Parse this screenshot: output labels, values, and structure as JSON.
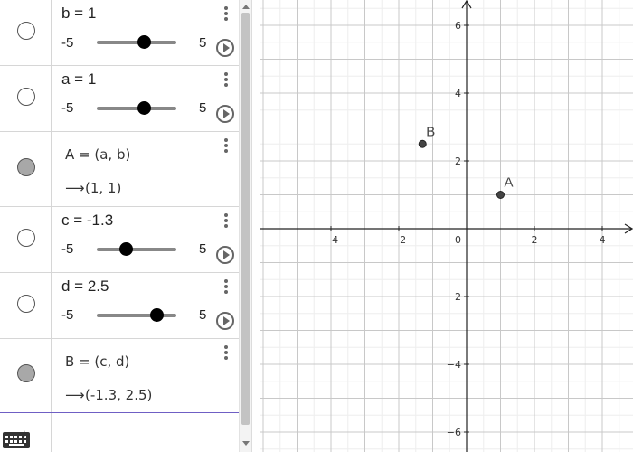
{
  "algebra": {
    "rows": [
      {
        "type": "slider",
        "label": "b = 1",
        "value": 1,
        "min_label": "-5",
        "max_label": "5",
        "min": -5,
        "max": 5
      },
      {
        "type": "slider",
        "label": "a = 1",
        "value": 1,
        "min_label": "-5",
        "max_label": "5",
        "min": -5,
        "max": 5
      },
      {
        "type": "point",
        "definition": "A = (a, b)",
        "result": "(1, 1)"
      },
      {
        "type": "slider",
        "label": "c = -1.3",
        "value": -1.3,
        "min_label": "-5",
        "max_label": "5",
        "min": -5,
        "max": 5
      },
      {
        "type": "slider",
        "label": "d = 2.5",
        "value": 2.5,
        "min_label": "-5",
        "max_label": "5",
        "min": -5,
        "max": 5
      },
      {
        "type": "point",
        "definition": "B = (c, d)",
        "result": "(-1.3, 2.5)"
      }
    ],
    "arrow_glyph": "⟶",
    "input_plus": "+"
  },
  "graphics": {
    "x_ticks": [
      {
        "value": -4,
        "label": "−4"
      },
      {
        "value": -2,
        "label": "−2"
      },
      {
        "value": 2,
        "label": "2"
      },
      {
        "value": 4,
        "label": "4"
      }
    ],
    "y_ticks": [
      {
        "value": 6,
        "label": "6"
      },
      {
        "value": 4,
        "label": "4"
      },
      {
        "value": 2,
        "label": "2"
      },
      {
        "value": -2,
        "label": "−2"
      },
      {
        "value": -4,
        "label": "−4"
      },
      {
        "value": -6,
        "label": "−6"
      }
    ],
    "origin_label": "0",
    "points": [
      {
        "name": "A",
        "x": 1,
        "y": 1
      },
      {
        "name": "B",
        "x": -1.3,
        "y": 2.5
      }
    ],
    "colors": {
      "grid_minor": "#eeeeee",
      "grid_major": "#c8c8c8",
      "axis": "#222222",
      "point": "#444444"
    }
  }
}
